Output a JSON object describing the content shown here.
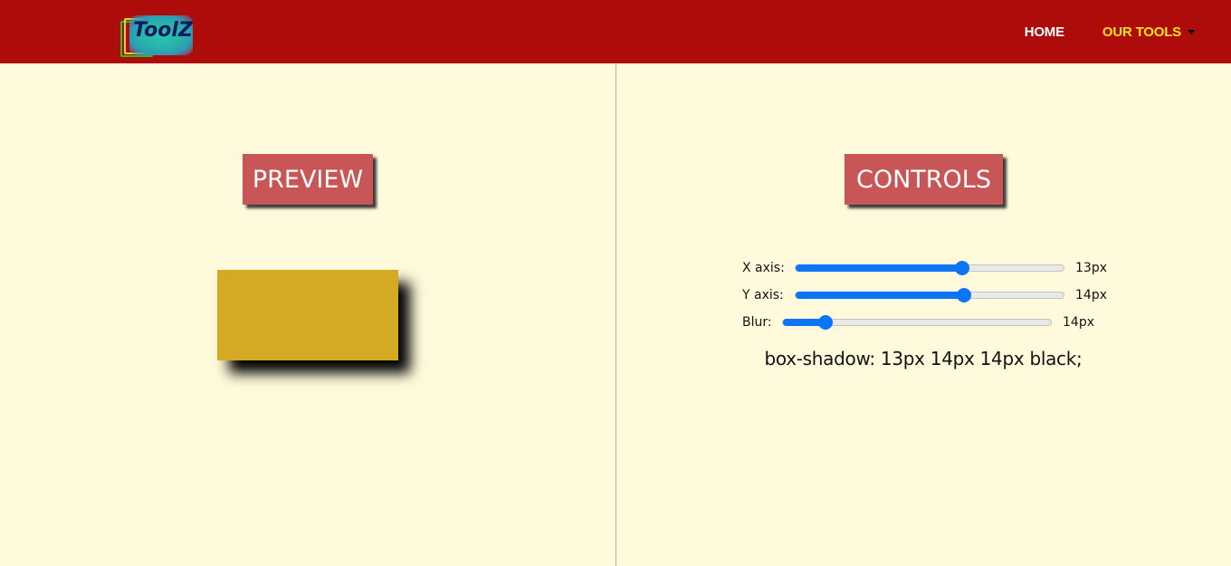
{
  "brand": {
    "logo_text": "ToolZ"
  },
  "nav": {
    "home": "HOME",
    "tools": "OUR TOOLS"
  },
  "preview": {
    "heading": "PREVIEW",
    "box_color": "#d4aa24"
  },
  "controls": {
    "heading": "CONTROLS",
    "sliders": [
      {
        "label": "X axis:",
        "value": "13px",
        "fraction": 0.62
      },
      {
        "label": "Y axis:",
        "value": "14px",
        "fraction": 0.63
      },
      {
        "label": "Blur:",
        "value": "14px",
        "fraction": 0.16
      }
    ],
    "result": "box-shadow: 13px 14px 14px black;"
  },
  "colors": {
    "navbar": "#ad0c0a",
    "background": "#fffadc",
    "heading_bg": "#c85656",
    "accent": "#0b75f5",
    "nav_active": "#ffe21a"
  },
  "icons": [
    "caret-down-icon"
  ]
}
